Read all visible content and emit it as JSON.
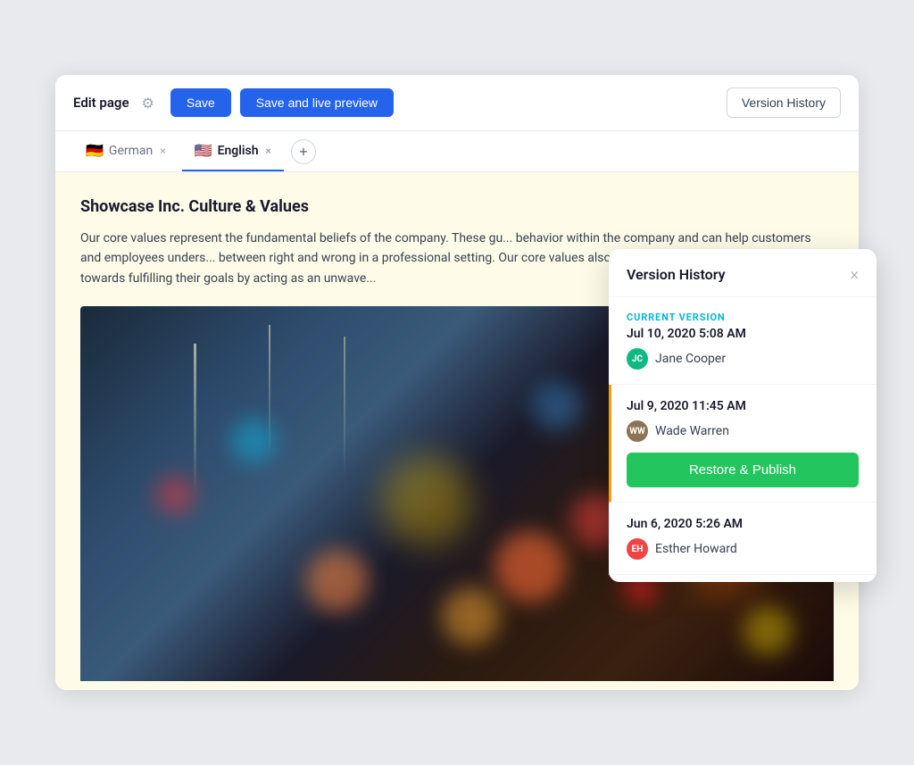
{
  "toolbar": {
    "edit_page_label": "Edit page",
    "save_label": "Save",
    "save_preview_label": "Save and live preview",
    "version_history_label": "Version History"
  },
  "tabs": [
    {
      "id": "german",
      "label": "German",
      "flag": "🇩🇪",
      "active": false
    },
    {
      "id": "english",
      "label": "English",
      "flag": "🇺🇸",
      "active": true
    }
  ],
  "content": {
    "title": "Showcase Inc. Culture & Values",
    "body": "Our core values represent the fundamental beliefs of the company. These gu... behavior within the company and can help customers and employees unders... between right and wrong in a professional setting. Our core values also help c... they are on the right path towards fulfilling their goals by acting as an unwave..."
  },
  "version_history": {
    "panel_title": "Version History",
    "close_label": "×",
    "entries": [
      {
        "id": "v1",
        "current": true,
        "current_label": "CURRENT VERSION",
        "date": "Jul 10, 2020 5:08 AM",
        "user": "Jane Cooper",
        "avatar_initials": "JC",
        "avatar_class": "avatar-jc",
        "selected": false
      },
      {
        "id": "v2",
        "current": false,
        "current_label": "",
        "date": "Jul 9, 2020 11:45 AM",
        "user": "Wade Warren",
        "avatar_initials": "WW",
        "avatar_class": "avatar-ww",
        "selected": true,
        "restore_label": "Restore & Publish"
      },
      {
        "id": "v3",
        "current": false,
        "current_label": "",
        "date": "Jun 6, 2020 5:26 AM",
        "user": "Esther Howard",
        "avatar_initials": "EH",
        "avatar_class": "avatar-eh",
        "selected": false
      }
    ]
  },
  "colors": {
    "accent_blue": "#2563eb",
    "accent_green": "#22c55e",
    "accent_cyan": "#06b6d4",
    "accent_amber": "#f59e0b"
  }
}
